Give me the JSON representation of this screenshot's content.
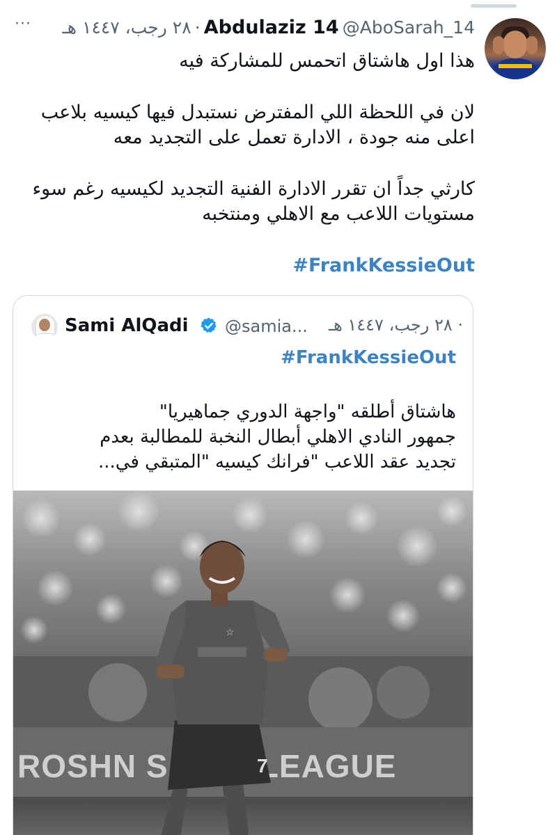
{
  "tweet": {
    "display_name": "Abdulaziz 14",
    "handle": "@AboSarah_14",
    "separator": "·",
    "date": "٢٨ رجب، ١٤٤٧ هـ",
    "more_icon": "more-horizontal-icon",
    "lines": [
      "هذا اول هاشتاق اتحمس للمشاركة فيه",
      "لان في اللحظة اللي المفترض نستبدل فيها كيسيه بلاعب",
      "اعلى منه جودة ، الادارة تعمل على التجديد معه",
      "كارثي جداً ان تقرر الادارة الفنية التجديد لكيسيه رغم سوء",
      "مستويات اللاعب مع الاهلي ومنتخبه"
    ],
    "hashtag": "#FrankKessieOut"
  },
  "quoted_tweet": {
    "display_name": "Sami AlQadi",
    "verified_icon": "verified-badge-icon",
    "handle": "@samia...",
    "separator": "·",
    "date": "٢٨ رجب، ١٤٤٧ هـ",
    "hashtag": "#FrankKessieOut",
    "lines": [
      "هاشتاق أطلقه \"واجهة الدوري جماهيريا\"",
      "جمهور النادي الاهلي أبطال النخبة للمطالبة بعدم",
      "تجديد عقد اللاعب \"فرانك كيسيه \"المتبقي في..."
    ],
    "photo": {
      "banner_text": "ROSHN SAUDI LEAGUE",
      "player_number": "7"
    }
  },
  "colors": {
    "link": "#3c83c4",
    "text_primary": "#0f1419",
    "text_secondary": "#536471",
    "border": "#cfd9de",
    "verified": "#1d9bf0"
  }
}
